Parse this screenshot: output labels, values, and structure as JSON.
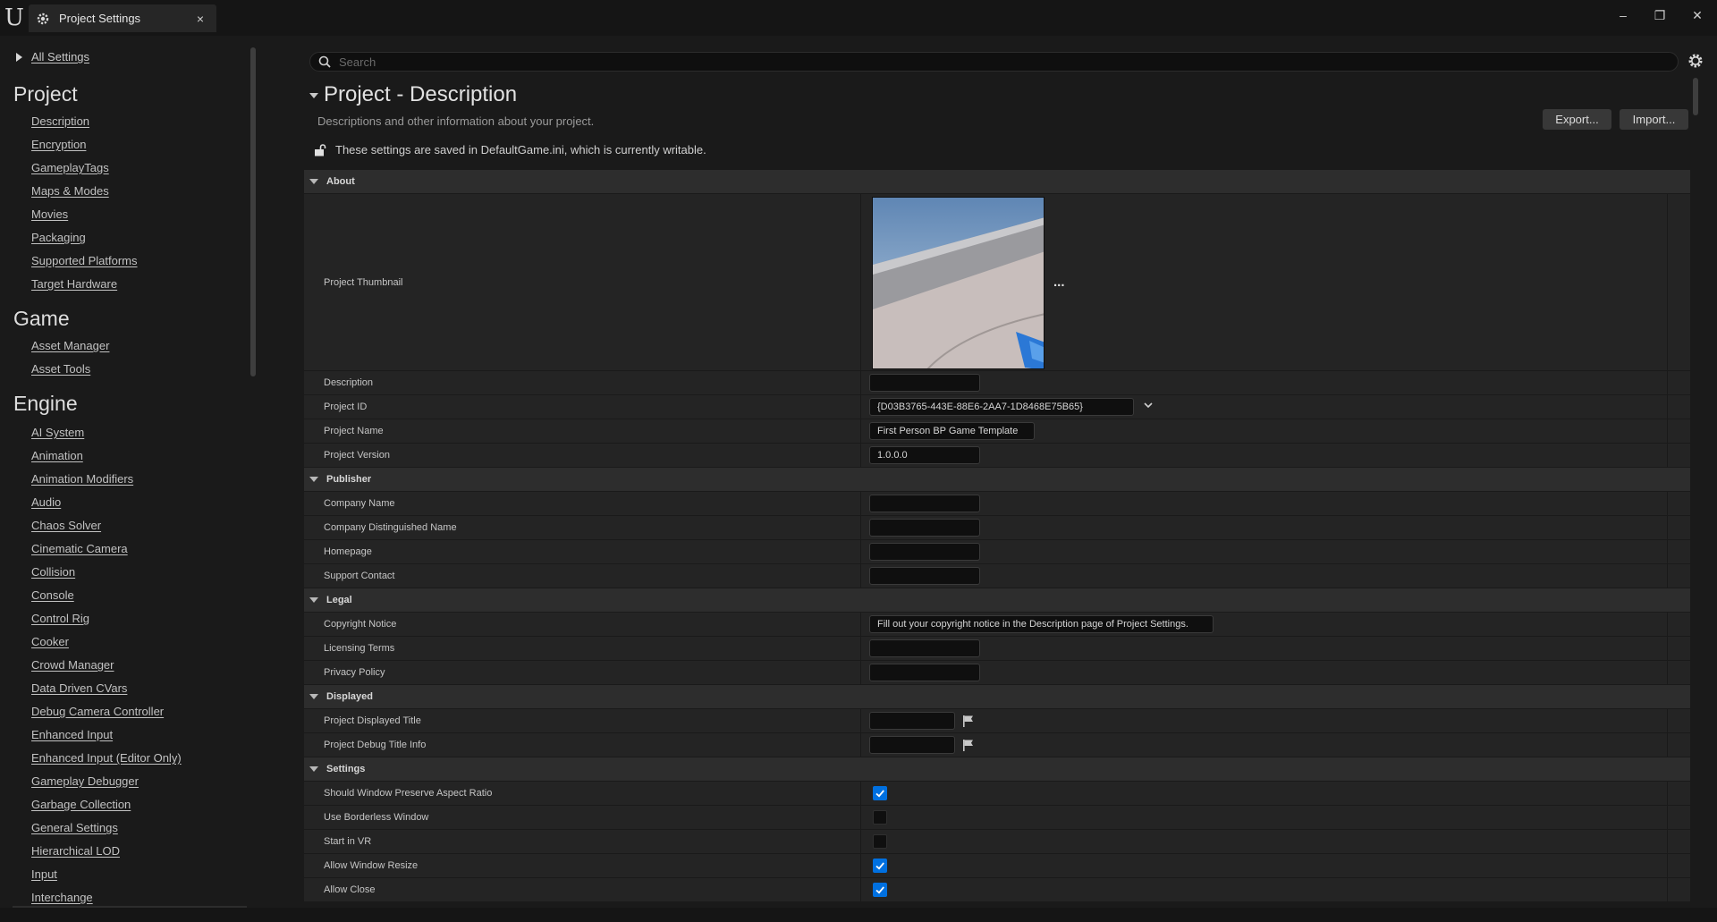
{
  "window": {
    "tab_title": "Project Settings",
    "tab_close": "×",
    "minimize": "–",
    "restore": "❐",
    "close": "✕",
    "logo": "U"
  },
  "sidebar": {
    "all_settings": "All Settings",
    "categories": [
      {
        "title": "Project",
        "items": [
          "Description",
          "Encryption",
          "GameplayTags",
          "Maps & Modes",
          "Movies",
          "Packaging",
          "Supported Platforms",
          "Target Hardware"
        ]
      },
      {
        "title": "Game",
        "items": [
          "Asset Manager",
          "Asset Tools"
        ]
      },
      {
        "title": "Engine",
        "items": [
          "AI System",
          "Animation",
          "Animation Modifiers",
          "Audio",
          "Chaos Solver",
          "Cinematic Camera",
          "Collision",
          "Console",
          "Control Rig",
          "Cooker",
          "Crowd Manager",
          "Data Driven CVars",
          "Debug Camera Controller",
          "Enhanced Input",
          "Enhanced Input (Editor Only)",
          "Gameplay Debugger",
          "Garbage Collection",
          "General Settings",
          "Hierarchical LOD",
          "Input",
          "Interchange"
        ]
      }
    ]
  },
  "search": {
    "placeholder": "Search",
    "value": ""
  },
  "header": {
    "title": "Project - Description",
    "description": "Descriptions and other information about your project.",
    "writable_notice": "These settings are saved in DefaultGame.ini, which is currently writable.",
    "export_label": "Export...",
    "import_label": "Import..."
  },
  "sections": [
    {
      "title": "About",
      "rows": [
        {
          "name": "Project Thumbnail",
          "type": "thumbnail",
          "more": "..."
        },
        {
          "name": "Description",
          "type": "text",
          "value": ""
        },
        {
          "name": "Project ID",
          "type": "dropdown",
          "value": "{D03B3765-443E-88E6-2AA7-1D8468E75B65}"
        },
        {
          "name": "Project Name",
          "type": "text",
          "value": "First Person BP Game Template"
        },
        {
          "name": "Project Version",
          "type": "text",
          "value": "1.0.0.0"
        }
      ]
    },
    {
      "title": "Publisher",
      "rows": [
        {
          "name": "Company Name",
          "type": "text",
          "value": ""
        },
        {
          "name": "Company Distinguished Name",
          "type": "text",
          "value": ""
        },
        {
          "name": "Homepage",
          "type": "text",
          "value": ""
        },
        {
          "name": "Support Contact",
          "type": "text",
          "value": ""
        }
      ]
    },
    {
      "title": "Legal",
      "rows": [
        {
          "name": "Copyright Notice",
          "type": "text",
          "value": "Fill out your copyright notice in the Description page of Project Settings."
        },
        {
          "name": "Licensing Terms",
          "type": "text",
          "value": ""
        },
        {
          "name": "Privacy Policy",
          "type": "text",
          "value": ""
        }
      ]
    },
    {
      "title": "Displayed",
      "rows": [
        {
          "name": "Project Displayed Title",
          "type": "localized",
          "value": ""
        },
        {
          "name": "Project Debug Title Info",
          "type": "localized",
          "value": ""
        }
      ]
    },
    {
      "title": "Settings",
      "rows": [
        {
          "name": "Should Window Preserve Aspect Ratio",
          "type": "checkbox",
          "checked": true
        },
        {
          "name": "Use Borderless Window",
          "type": "checkbox",
          "checked": false
        },
        {
          "name": "Start in VR",
          "type": "checkbox",
          "checked": false
        },
        {
          "name": "Allow Window Resize",
          "type": "checkbox",
          "checked": true
        },
        {
          "name": "Allow Close",
          "type": "checkbox",
          "checked": true
        }
      ]
    }
  ],
  "colors": {
    "accent": "#0070e0",
    "background": "#1a1a1a",
    "row": "#242424",
    "section": "#2d2d2d"
  }
}
